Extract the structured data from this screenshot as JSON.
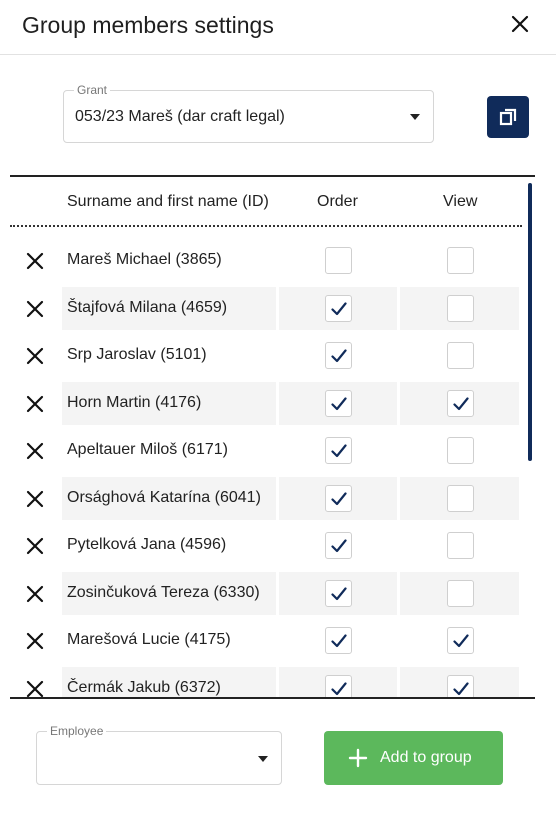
{
  "dialog": {
    "title": "Group members settings",
    "close_icon": "close-icon"
  },
  "grant": {
    "label": "Grant",
    "value": "053/23 Mareš (dar craft legal)",
    "copy_icon": "copy-icon"
  },
  "table": {
    "columns": {
      "name": "Surname and first name (ID)",
      "order": "Order",
      "view": "View"
    },
    "rows": [
      {
        "name": "Mareš Michael (3865)",
        "order": false,
        "view": false
      },
      {
        "name": "Štajfová Milana (4659)",
        "order": true,
        "view": false
      },
      {
        "name": "Srp Jaroslav (5101)",
        "order": true,
        "view": false
      },
      {
        "name": "Horn Martin (4176)",
        "order": true,
        "view": true
      },
      {
        "name": "Apeltauer Miloš (6171)",
        "order": true,
        "view": false
      },
      {
        "name": "Orsághová Katarína (6041)",
        "order": true,
        "view": false
      },
      {
        "name": "Pytelková Jana (4596)",
        "order": true,
        "view": false
      },
      {
        "name": "Zosinčuková Tereza (6330)",
        "order": true,
        "view": false
      },
      {
        "name": "Marešová Lucie (4175)",
        "order": true,
        "view": true
      },
      {
        "name": "Čermák Jakub (6372)",
        "order": true,
        "view": true
      }
    ]
  },
  "employee": {
    "label": "Employee",
    "value": ""
  },
  "add_button": {
    "label": "Add to group",
    "icon": "plus-icon",
    "color": "#5cb85c"
  },
  "colors": {
    "primary": "#102b5a",
    "check": "#102b5a",
    "row_alt": "#f4f4f4"
  }
}
